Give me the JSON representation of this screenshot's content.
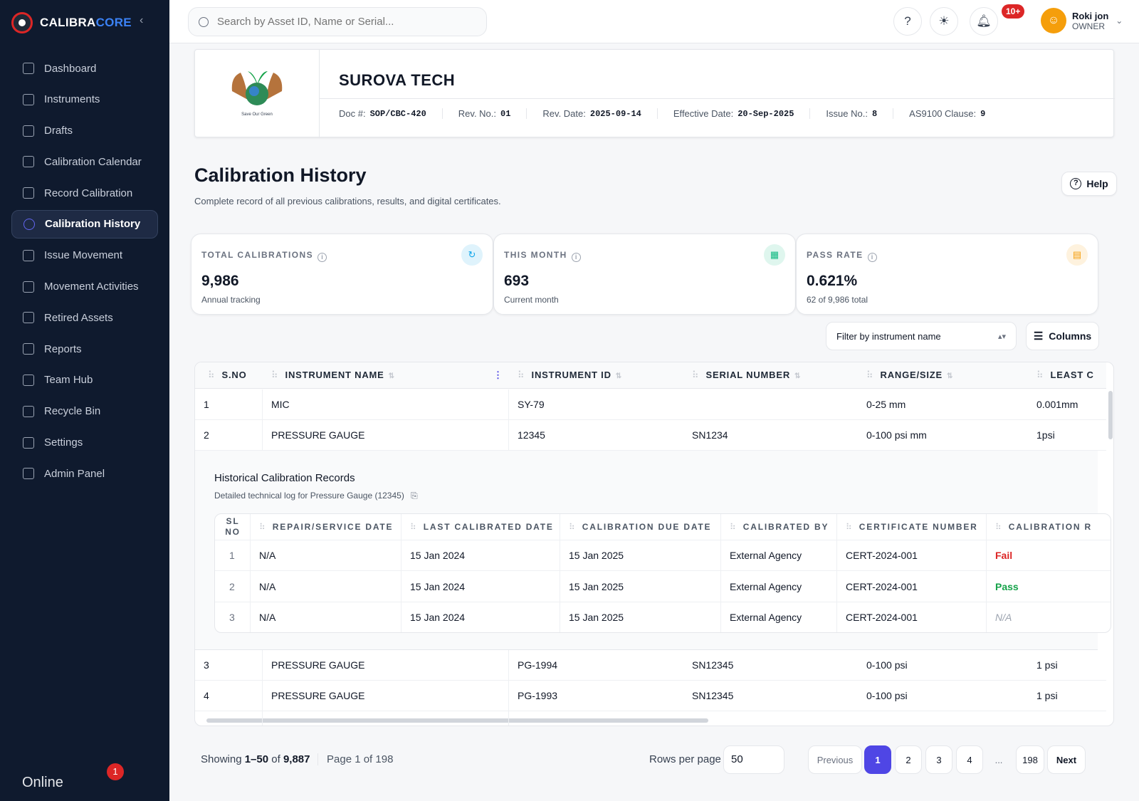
{
  "app": {
    "brand_main": "CALIBRA",
    "brand_accent": "CORE"
  },
  "sidebar": {
    "items": [
      {
        "label": "Dashboard",
        "icon": "dashboard-icon"
      },
      {
        "label": "Instruments",
        "icon": "clipboard-icon"
      },
      {
        "label": "Drafts",
        "icon": "drafts-icon"
      },
      {
        "label": "Calibration Calendar",
        "icon": "calendar-icon"
      },
      {
        "label": "Record Calibration",
        "icon": "clipboard-check-icon"
      },
      {
        "label": "Calibration History",
        "icon": "history-icon",
        "active": true
      },
      {
        "label": "Issue Movement",
        "icon": "send-icon"
      },
      {
        "label": "Movement Activities",
        "icon": "arrows-icon"
      },
      {
        "label": "Retired Assets",
        "icon": "archive-icon"
      },
      {
        "label": "Reports",
        "icon": "report-icon"
      },
      {
        "label": "Team Hub",
        "icon": "users-icon"
      },
      {
        "label": "Recycle Bin",
        "icon": "trash-icon"
      },
      {
        "label": "Settings",
        "icon": "gear-icon"
      },
      {
        "label": "Admin Panel",
        "icon": "shield-icon"
      }
    ],
    "status": "Online",
    "status_badge": "1"
  },
  "topbar": {
    "search_placeholder": "Search by Asset ID, Name or Serial...",
    "notif_badge": "10+",
    "user_name": "Roki jon",
    "user_role": "OWNER"
  },
  "company": {
    "logo_caption": "Save Our Green",
    "name": "SUROVA TECH",
    "meta": [
      {
        "label": "Doc #:",
        "value": "SOP/CBC-420"
      },
      {
        "label": "Rev. No.:",
        "value": "01"
      },
      {
        "label": "Rev. Date:",
        "value": "2025-09-14"
      },
      {
        "label": "Effective Date:",
        "value": "20-Sep-2025"
      },
      {
        "label": "Issue No.:",
        "value": "8"
      },
      {
        "label": "AS9100 Clause:",
        "value": "9"
      }
    ]
  },
  "page": {
    "title": "Calibration History",
    "subtitle": "Complete record of all previous calibrations, results, and digital certificates.",
    "help_label": "Help"
  },
  "stats": [
    {
      "label": "TOTAL CALIBRATIONS",
      "value": "9,986",
      "note": "Annual tracking",
      "icon": "history-icon",
      "color": "#0ea5e9"
    },
    {
      "label": "THIS MONTH",
      "value": "693",
      "note": "Current month",
      "icon": "calendar-icon",
      "color": "#10b981"
    },
    {
      "label": "PASS RATE",
      "value": "0.621%",
      "note": "62 of 9,986 total",
      "icon": "document-icon",
      "color": "#f59e0b"
    }
  ],
  "filter": {
    "placeholder": "Filter by instrument name",
    "columns_label": "Columns"
  },
  "table": {
    "headers": [
      "S.NO",
      "INSTRUMENT NAME",
      "INSTRUMENT ID",
      "SERIAL NUMBER",
      "RANGE/SIZE",
      "LEAST C"
    ],
    "rows_top": [
      [
        "1",
        "MIC",
        "SY-79",
        "",
        "0-25 mm",
        "0.001mm"
      ],
      [
        "2",
        "PRESSURE GAUGE",
        "12345",
        "SN1234",
        "0-100 psi mm",
        "1psi"
      ]
    ],
    "rows_bottom": [
      [
        "3",
        "PRESSURE GAUGE",
        "PG-1994",
        "SN12345",
        "0-100 psi",
        "1 psi"
      ],
      [
        "4",
        "PRESSURE GAUGE",
        "PG-1993",
        "SN12345",
        "0-100 psi",
        "1 psi"
      ]
    ]
  },
  "history": {
    "title": "Historical Calibration Records",
    "subtitle": "Detailed technical log for Pressure Gauge (12345)",
    "headers": [
      "SL NO",
      "REPAIR/SERVICE DATE",
      "LAST CALIBRATED DATE",
      "CALIBRATION DUE DATE",
      "CALIBRATED BY",
      "CERTIFICATE NUMBER",
      "CALIBRATION R"
    ],
    "rows": [
      [
        "1",
        "N/A",
        "15 Jan 2024",
        "15 Jan 2025",
        "External Agency",
        "CERT-2024-001",
        "Fail"
      ],
      [
        "2",
        "N/A",
        "15 Jan 2024",
        "15 Jan 2025",
        "External Agency",
        "CERT-2024-001",
        "Pass"
      ],
      [
        "3",
        "N/A",
        "15 Jan 2024",
        "15 Jan 2025",
        "External Agency",
        "CERT-2024-001",
        "N/A"
      ]
    ]
  },
  "pagination": {
    "showing_prefix": "Showing ",
    "showing_range": "1–50",
    "showing_of": " of ",
    "showing_total": "9,887",
    "page_info": "Page 1 of 198",
    "rows_per_page_label": "Rows per page",
    "rows_per_page": "50",
    "previous": "Previous",
    "pages": [
      "1",
      "2",
      "3",
      "4"
    ],
    "ellipsis": "...",
    "last_page": "198",
    "next": "Next"
  }
}
